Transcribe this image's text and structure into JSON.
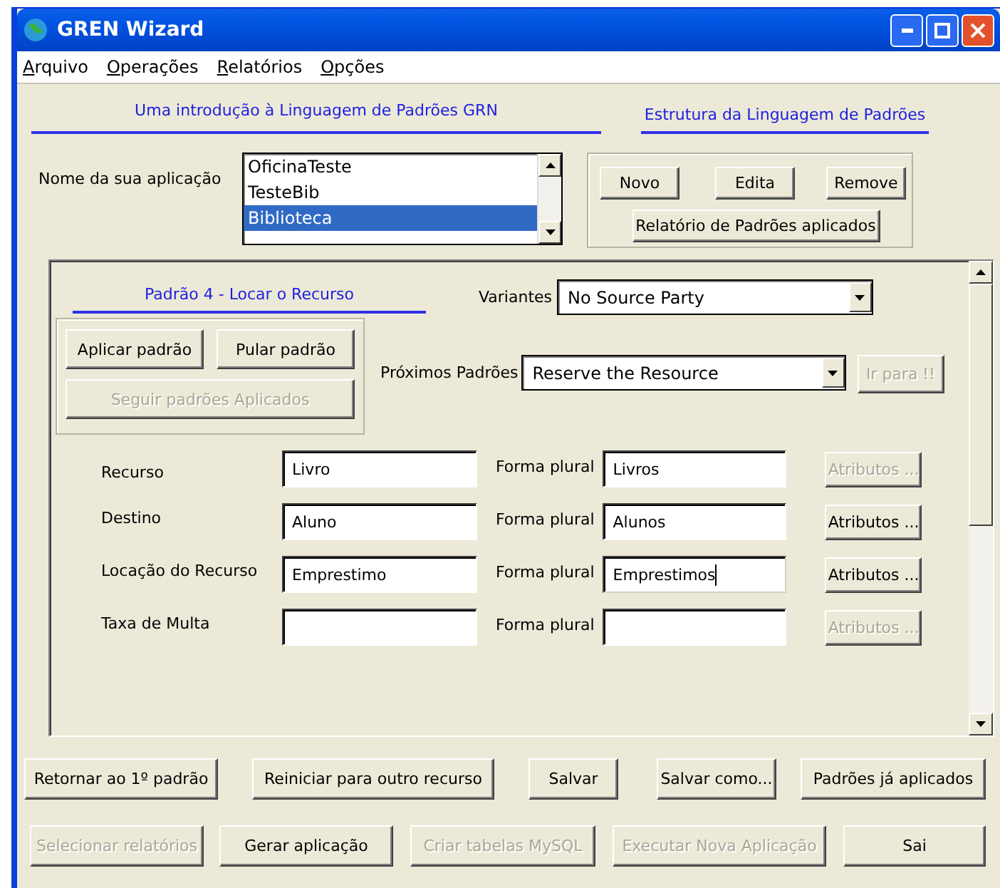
{
  "window": {
    "title": "GREN Wizard"
  },
  "menu": [
    "Arquivo",
    "Operações",
    "Relatórios",
    "Opções"
  ],
  "intro_link": "Uma introdução à Linguagem de Padrões GRN",
  "structure_link": "Estrutura da Linguagem de Padrões",
  "application": {
    "label": "Nome da sua aplicação",
    "items": [
      {
        "label": "OficinaTeste",
        "selected": false
      },
      {
        "label": "TesteBib",
        "selected": false
      },
      {
        "label": "Biblioteca",
        "selected": true
      }
    ]
  },
  "app_buttons": [
    {
      "label": "Novo",
      "disabled": false
    },
    {
      "label": "Edita",
      "disabled": false
    },
    {
      "label": "Remove",
      "disabled": false
    }
  ],
  "report_button": {
    "label": "Relatório de Padrões aplicados",
    "disabled": false
  },
  "pattern": {
    "title": "Padrão 4 - Locar o Recurso",
    "variants": {
      "label": "Variantes",
      "value": "No Source Party"
    },
    "actions": [
      {
        "label": "Aplicar padrão",
        "disabled": false
      },
      {
        "label": "Pular padrão",
        "disabled": false
      }
    ],
    "follow_button": {
      "label": "Seguir padrões Aplicados",
      "disabled": true
    },
    "next": {
      "label": "Próximos Padrões",
      "value": "Reserve the Resource"
    },
    "goto_button": {
      "label": "Ir para !!",
      "disabled": true
    },
    "fields": [
      {
        "label": "Recurso",
        "value": "Livro",
        "plural_label": "Forma plural",
        "plural": "Livros",
        "button": {
          "label": "Atributos ...",
          "disabled": true
        },
        "focused": false
      },
      {
        "label": "Destino",
        "value": "Aluno",
        "plural_label": "Forma plural",
        "plural": "Alunos",
        "button": {
          "label": "Atributos ...",
          "disabled": false
        },
        "focused": false
      },
      {
        "label": "Locação do Recurso",
        "value": "Emprestimo",
        "plural_label": "Forma plural",
        "plural": "Emprestimos",
        "button": {
          "label": "Atributos ...",
          "disabled": false
        },
        "focused": true
      },
      {
        "label": "Taxa de Multa",
        "plural_label": "Forma plural",
        "button": {
          "label": "Atributos ...",
          "disabled": true
        },
        "focused": false
      }
    ]
  },
  "buttons_row1": [
    {
      "label": "Retornar ao 1º padrão",
      "disabled": false
    },
    {
      "label": "Reiniciar para outro recurso",
      "disabled": false
    },
    {
      "label": "Salvar",
      "disabled": false
    },
    {
      "label": "Salvar como...",
      "disabled": false
    },
    {
      "label": "Padrões já aplicados",
      "disabled": false
    }
  ],
  "buttons_row2": [
    {
      "label": "Selecionar relatórios",
      "disabled": true
    },
    {
      "label": "Gerar aplicação",
      "disabled": false
    },
    {
      "label": "Criar tabelas MySQL",
      "disabled": true
    },
    {
      "label": "Executar Nova Aplicação",
      "disabled": true
    },
    {
      "label": "Sai",
      "disabled": false
    }
  ]
}
